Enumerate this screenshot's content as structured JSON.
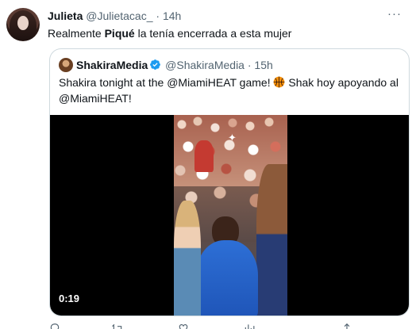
{
  "tweet": {
    "author_name": "Julieta",
    "author_handle": "@Julietacac_",
    "separator": "·",
    "time": "14h",
    "more_label": "···",
    "text_before": "Realmente ",
    "text_bold": "Piqué",
    "text_after": " la tenía encerrada a esta mujer"
  },
  "quoted": {
    "author_name": "ShakiraMedia",
    "author_handle": "@ShakiraMedia",
    "separator": "·",
    "time": "15h",
    "text_part1": "Shakira tonight at the @MiamiHEAT game! ",
    "text_part2": " Shak hoy apoyando al @MiamiHEAT!",
    "verified_color": "#1d9bf0",
    "video": {
      "duration": "0:19"
    }
  },
  "icons": [
    "avatar",
    "verified-badge-icon",
    "basketball-emoji-icon",
    "sparkle-icon",
    "reply-icon",
    "repost-icon",
    "like-icon",
    "views-icon",
    "share-icon"
  ],
  "colors": {
    "secondary_text": "#536471",
    "border": "#cfd9de",
    "accent": "#1d9bf0"
  }
}
